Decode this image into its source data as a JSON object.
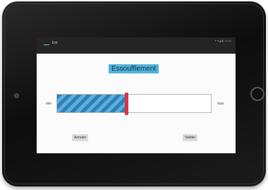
{
  "app": {
    "nav_label": "Ent",
    "status_text": "✦ ▾◢ ▮ 14:45"
  },
  "main": {
    "title": "Essoufflement",
    "slider": {
      "min_label": "min",
      "max_label": "max",
      "value_fraction": 0.45,
      "fill_color": "#2f7fb4",
      "handle_color": "#e0333f"
    },
    "buttons": {
      "cancel": "Annuler",
      "ok": "Valider"
    }
  },
  "colors": {
    "accent": "#4fb3de",
    "topbar": "#242424"
  }
}
